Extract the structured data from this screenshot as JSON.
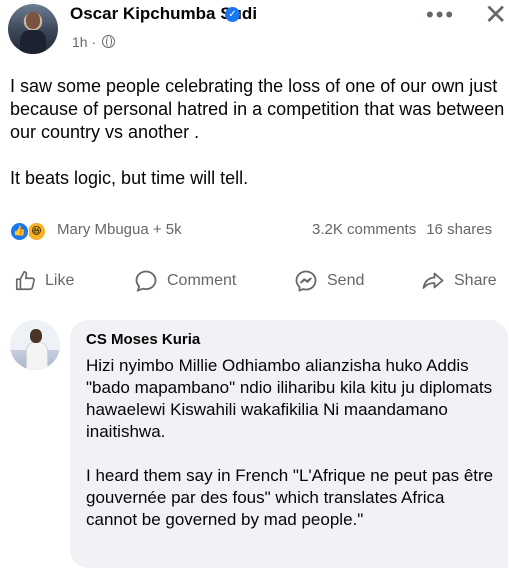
{
  "post": {
    "author": "Oscar Kipchumba Sudi",
    "time": "1h ·",
    "paragraphs": [
      "I saw some people celebrating the loss of one of our own just because of personal hatred in a competition that was between our country vs another .",
      "It beats logic, but time will tell."
    ]
  },
  "reactions": {
    "names": "Mary Mbugua + 5k",
    "comments": "3.2K comments",
    "shares": "16 shares"
  },
  "actions": {
    "like": "Like",
    "comment": "Comment",
    "send": "Send",
    "share": "Share"
  },
  "comment": {
    "author": "CS Moses Kuria",
    "paragraphs": [
      "Hizi nyimbo Millie Odhiambo alianzisha huko Addis \"bado mapambano\" ndio iliharibu kila kitu ju diplomats hawaelewi Kiswahili wakafikilia Ni maandamano inaitishwa.",
      "I heard them say in French \"L'Afrique ne peut pas être gouvernée par des fous\" which translates Africa cannot be governed by mad people.\""
    ]
  },
  "icons": {
    "verified": "verified-badge-icon",
    "privacy": "globe-icon",
    "more": "more-dots-icon",
    "close": "close-icon"
  },
  "colors": {
    "brand_blue": "#1877f2",
    "muted_text": "#65676b",
    "bubble_bg": "#f0f2f5"
  }
}
